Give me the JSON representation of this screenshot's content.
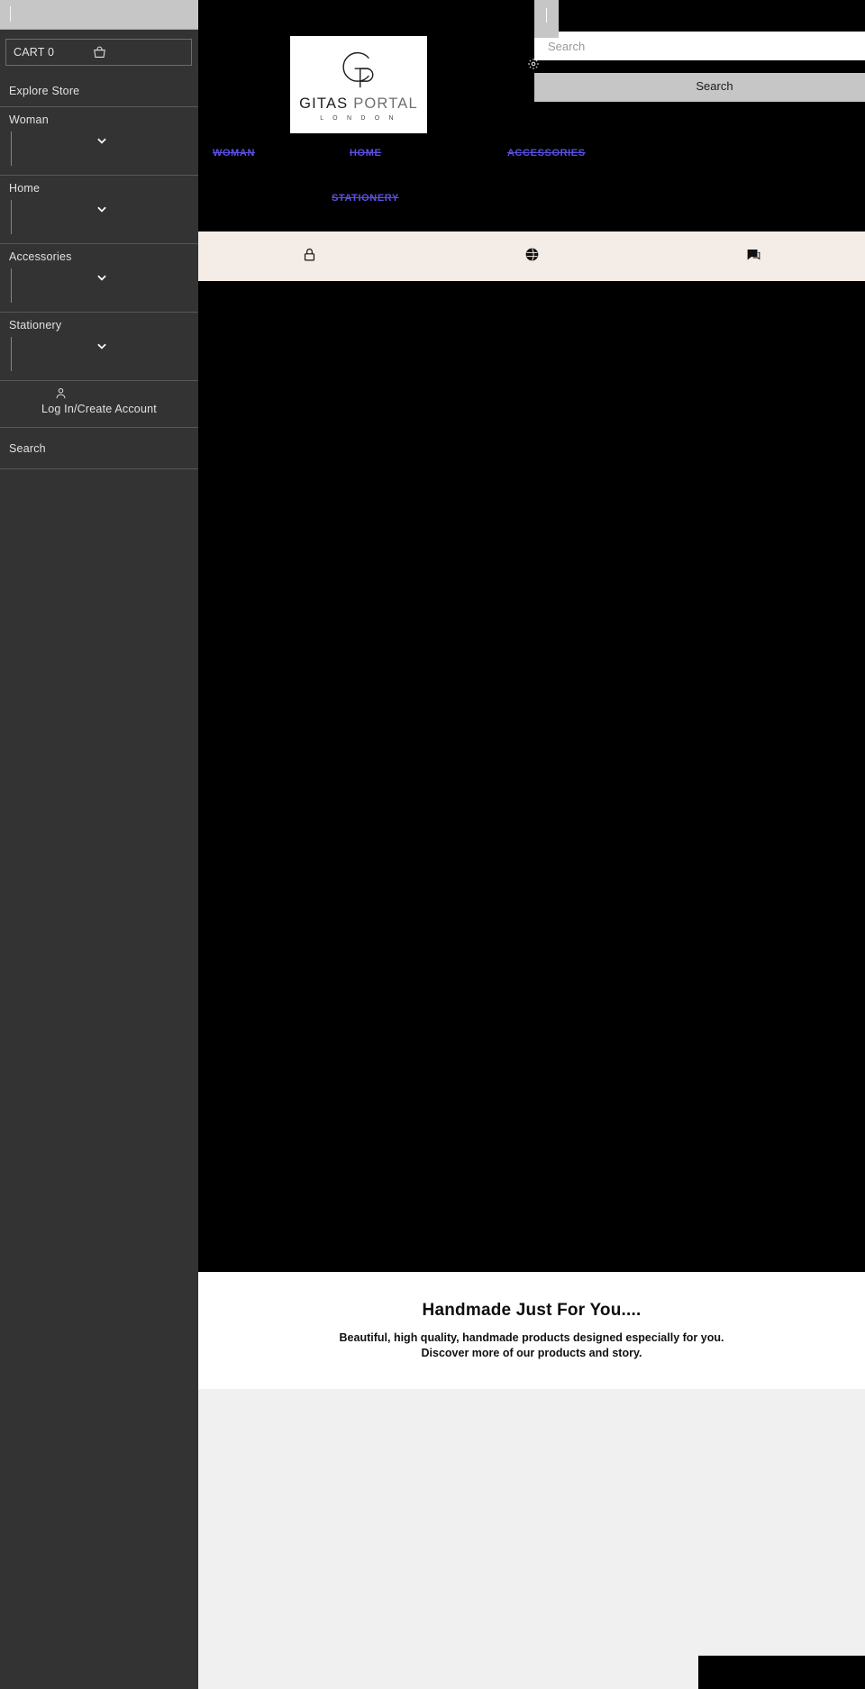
{
  "sidebar": {
    "top_field": {
      "value": "",
      "caret": true
    },
    "cart": {
      "label": "CART 0",
      "icon": "shopping-bag-icon"
    },
    "explore": {
      "label": "Explore Store"
    },
    "groups": [
      {
        "label": "Woman",
        "chevron": "chevron-down-icon"
      },
      {
        "label": "Home",
        "chevron": "chevron-down-icon"
      },
      {
        "label": "Accessories",
        "chevron": "chevron-down-icon"
      },
      {
        "label": "Stationery",
        "chevron": "chevron-down-icon"
      }
    ],
    "account": {
      "label": "Log In/Create Account",
      "icon": "person-icon"
    },
    "search": {
      "label": "Search"
    }
  },
  "header": {
    "mini_box_value": "",
    "search_placeholder": "Search",
    "search_button_label": "Search",
    "gear_icon": "gear-icon"
  },
  "logo": {
    "mark": "gp-monogram-icon",
    "word_primary": "GITAS",
    "word_secondary": "PORTAL",
    "sub": "L O N D O N"
  },
  "nav": {
    "link_color": "#5a4fe0",
    "items": [
      {
        "label": "WOMAN"
      },
      {
        "label": "HOME"
      },
      {
        "label": "ACCESSORIES"
      },
      {
        "label": "STATIONERY"
      }
    ]
  },
  "icon_strip": {
    "background": "#f4ece6",
    "items": [
      {
        "icon": "lock-icon"
      },
      {
        "icon": "globe-icon"
      },
      {
        "icon": "chat-bubble-icon"
      }
    ]
  },
  "promo": {
    "heading": "Handmade Just For You....",
    "line1": "Beautiful, high quality, handmade products designed especially for you.",
    "line2": "Discover more of our products and story."
  }
}
